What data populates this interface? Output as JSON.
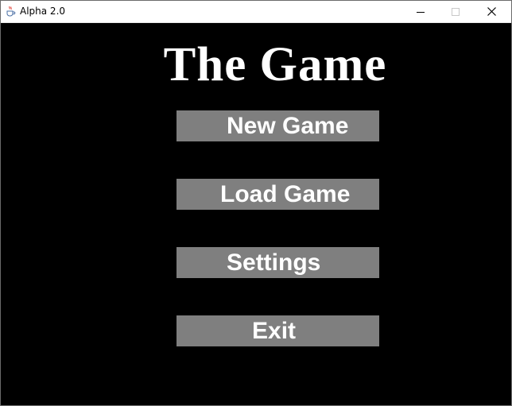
{
  "window": {
    "title": "Alpha 2.0",
    "app_icon": "java-cup-icon",
    "controls": {
      "minimize_icon": "minimize-icon",
      "maximize_icon": "maximize-icon",
      "close_icon": "close-icon"
    }
  },
  "game": {
    "title": "The Game",
    "menu": [
      {
        "label": "New Game"
      },
      {
        "label": "Load Game"
      },
      {
        "label": "Settings"
      },
      {
        "label": "Exit"
      }
    ]
  },
  "colors": {
    "background": "#000000",
    "button_fill": "#7f7f7f",
    "text": "#ffffff",
    "titlebar": "#ffffff"
  }
}
